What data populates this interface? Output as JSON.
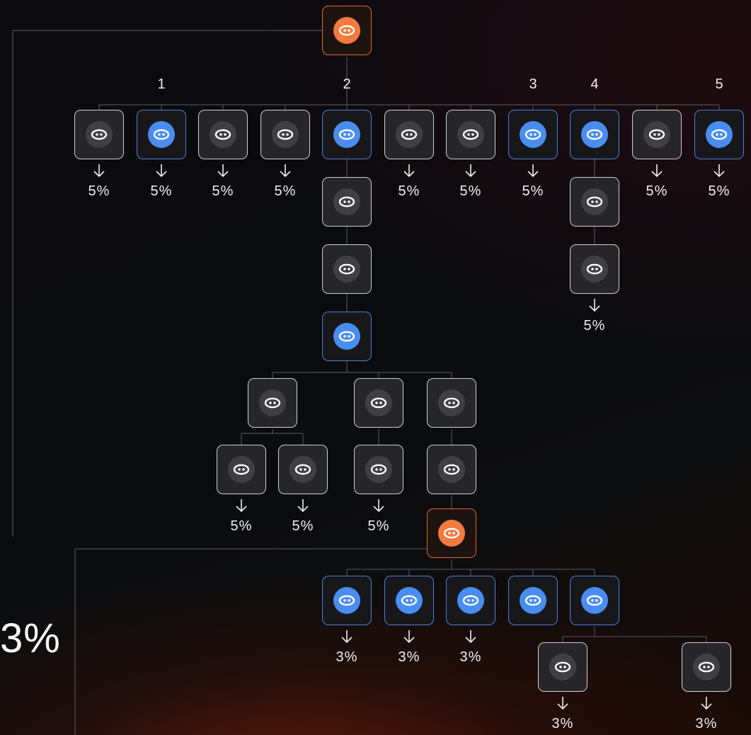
{
  "labels": {
    "col1": "1",
    "col2": "2",
    "col3": "3",
    "col4": "4",
    "col5": "5",
    "p5": "5%",
    "p3": "3%",
    "summary": "3%"
  },
  "icon_name": "agent-icon",
  "colors": {
    "orange_node": "#f47a3f",
    "blue_node": "#4a8df2",
    "gray_node": "#404044",
    "wire": "#5c5c62"
  }
}
